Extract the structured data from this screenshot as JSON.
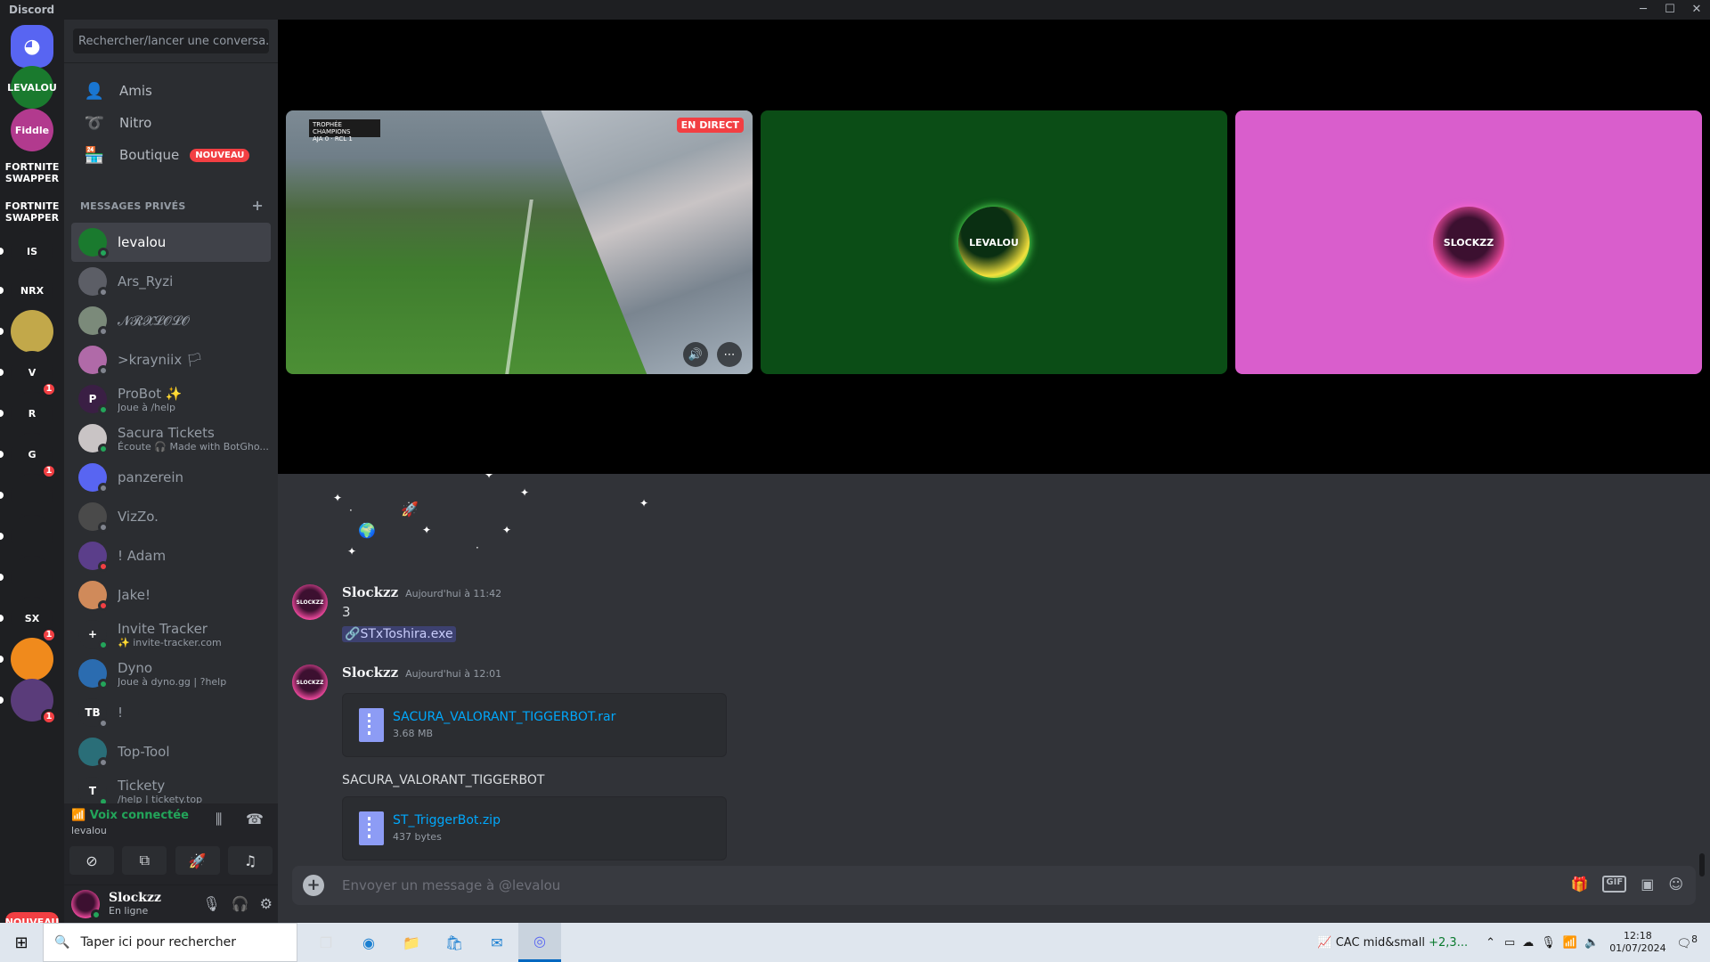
{
  "window": {
    "title": "Discord",
    "min_icon": "minimize-icon",
    "max_icon": "maximize-icon",
    "close_icon": "close-icon"
  },
  "servers": [
    {
      "label": "",
      "icon": "discord-logo-icon",
      "color": "#5865f2"
    },
    {
      "label": "LEVALOU",
      "color": "#1a7a2e"
    },
    {
      "label": "Fiddle",
      "color": "#b23a8e"
    },
    {
      "label": "FORTNITE SWAPPER",
      "color": "#1e1f22"
    },
    {
      "label": "FORTNITE SWAPPER",
      "color": "#1e1f22"
    },
    {
      "label": "IS",
      "color": "#1e1f22"
    },
    {
      "label": "NRX",
      "color": "#1e1f22"
    },
    {
      "label": "",
      "color": "#c2a84a"
    },
    {
      "label": "V",
      "color": "#1e1f22",
      "badge": "1"
    },
    {
      "label": "R",
      "color": "#1e1f22"
    },
    {
      "label": "G",
      "color": "#1e1f22",
      "badge": "1"
    },
    {
      "label": "",
      "color": "#1e1f22"
    },
    {
      "label": "",
      "color": "#1e1f22"
    },
    {
      "label": "",
      "color": "#1e1f22"
    },
    {
      "label": "SX",
      "color": "#1e1f22",
      "badge": "1"
    },
    {
      "label": "",
      "color": "#f08a1c"
    },
    {
      "label": "",
      "color": "#5a3c7a",
      "badge": "1"
    }
  ],
  "servers_new_label": "NOUVEAU",
  "search": {
    "placeholder": "Rechercher/lancer une conversa..."
  },
  "nav": {
    "friends": "Amis",
    "nitro": "Nitro",
    "shop": "Boutique",
    "shop_badge": "NOUVEAU"
  },
  "dm_header": "MESSAGES PRIVÉS",
  "dm_add": "+",
  "dms": [
    {
      "name": "levalou",
      "sub": "",
      "color": "#1a7a2e",
      "status": "#23a55a",
      "active": true,
      "initials": ""
    },
    {
      "name": "Ars_Ryzi",
      "sub": "",
      "color": "#5c5e66",
      "status": "#80848e",
      "initials": ""
    },
    {
      "name": "𝓝𝓡𝓧𝓛𝓞𝓛𝓞",
      "sub": "",
      "color": "#7b8a7a",
      "status": "#80848e",
      "initials": ""
    },
    {
      "name": ">krayniix 🏳",
      "sub": "",
      "color": "#b06aa8",
      "status": "#80848e",
      "initials": ""
    },
    {
      "name": "ProBot ✨",
      "sub": "Joue à /help",
      "color": "#3a1f44",
      "status": "#23a55a",
      "initials": "P"
    },
    {
      "name": "Sacura Tickets",
      "sub": "Écoute 🎧 Made with BotGho...",
      "color": "#c9c4c5",
      "status": "#23a55a",
      "initials": ""
    },
    {
      "name": "panzerein",
      "sub": "",
      "color": "#5865f2",
      "status": "#80848e",
      "initials": ""
    },
    {
      "name": "VizZo.",
      "sub": "",
      "color": "#4a4a4a",
      "status": "#80848e",
      "initials": ""
    },
    {
      "name": "! Adam",
      "sub": "",
      "color": "#5b3e8a",
      "status": "#f23f43",
      "initials": ""
    },
    {
      "name": "Jake!",
      "sub": "",
      "color": "#d08a5a",
      "status": "#f23f43",
      "initials": ""
    },
    {
      "name": "Invite Tracker",
      "sub": "✨ invite-tracker.com",
      "color": "#2b2d31",
      "status": "#23a55a",
      "initials": "+"
    },
    {
      "name": "Dyno",
      "sub": "Joue à dyno.gg | ?help",
      "color": "#2b6cb0",
      "status": "#23a55a",
      "initials": ""
    },
    {
      "name": "!",
      "sub": "",
      "color": "#2b2d31",
      "status": "#80848e",
      "initials": "TB"
    },
    {
      "name": "Top-Tool",
      "sub": "",
      "color": "#2a6e78",
      "status": "#80848e",
      "initials": ""
    },
    {
      "name": "Tickety",
      "sub": "/help | tickety.top",
      "color": "#2b2d31",
      "status": "#23a55a",
      "initials": "T"
    }
  ],
  "voice": {
    "title": "Voix connectée",
    "channel": "levalou",
    "signal_icon": "signal-icon",
    "wave_icon": "soundwave-icon",
    "hangup_icon": "hangup-icon"
  },
  "voice_buttons": [
    "camera-off-icon",
    "screen-share-icon",
    "activity-icon",
    "soundboard-icon"
  ],
  "user": {
    "name": "Slockzz",
    "status": "En ligne"
  },
  "stage": {
    "live_label": "EN DIRECT",
    "score_text": "AJA 0 · RCL 1",
    "scoreboard_header": "TROPHÉE CHAMPIONS",
    "avatar1": "LEVALOU",
    "avatar2": "SLOCKZZ",
    "tile1_color": "#3f7d2e",
    "tile2_color": "#0b4d16",
    "tile3_color": "#d95ecc"
  },
  "messages": [
    {
      "author": "Slockzz",
      "time": "Aujourd'hui à 11:42",
      "text": "3",
      "mention": "STxToshira.exe"
    },
    {
      "author": "Slockzz",
      "time": "Aujourd'hui à 12:01",
      "attachment1": {
        "name": "SACURA_VALORANT_TIGGERBOT.rar",
        "size": "3.68 MB"
      },
      "text": "SACURA_VALORANT_TIGGERBOT",
      "attachment2": {
        "name": "ST_TriggerBot.zip",
        "size": "437 bytes"
      }
    }
  ],
  "composer": {
    "placeholder": "Envoyer un message à @levalou",
    "icons": [
      "gift-icon",
      "gif-icon",
      "sticker-icon",
      "emoji-icon"
    ]
  },
  "taskbar": {
    "search_placeholder": "Taper ici pour rechercher",
    "stock_name": "CAC mid&small",
    "stock_change": "+2,3...",
    "time": "12:18",
    "date": "01/07/2024",
    "notifications": "8",
    "apps": [
      "task-view-icon",
      "edge-icon",
      "file-explorer-icon",
      "store-icon",
      "mail-icon",
      "discord-icon"
    ]
  }
}
